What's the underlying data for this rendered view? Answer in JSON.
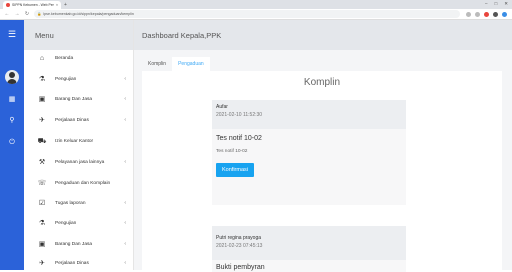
{
  "browser": {
    "tab_title": "SIPPN Kebumen - Web Pengad",
    "tab_close": "×",
    "new_tab": "+",
    "url": "lpse.kebumenkab.go.id/sippn/kepala/pengaduan/kemplin",
    "win_minimize": "–",
    "win_maximize": "□",
    "win_close": "✕"
  },
  "menu": {
    "title": "Menu",
    "items": [
      {
        "label": "Beranda",
        "icon": "home-icon",
        "chevron": ""
      },
      {
        "label": "Pengujian",
        "icon": "flask-icon",
        "chevron": "‹"
      },
      {
        "label": "Barang Dan Jasa",
        "icon": "box-icon",
        "chevron": "‹"
      },
      {
        "label": "Perjalaan Dinas",
        "icon": "plane-icon",
        "chevron": "‹"
      },
      {
        "label": "Izin Keluar Kantor",
        "icon": "car-icon",
        "chevron": ""
      },
      {
        "label": "Pelayanan jasa lainnya",
        "icon": "wrench-icon",
        "chevron": "‹"
      },
      {
        "label": "Pengaduan dan Komplain",
        "icon": "complaint-icon",
        "chevron": ""
      },
      {
        "label": "Tugas laporan",
        "icon": "checklist-icon",
        "chevron": "‹"
      },
      {
        "label": "Pengujian",
        "icon": "flask-icon",
        "chevron": "‹"
      },
      {
        "label": "Barang Dan Jasa",
        "icon": "box-icon",
        "chevron": "‹"
      },
      {
        "label": "Perjalaan Dinas",
        "icon": "plane-icon",
        "chevron": "‹"
      }
    ]
  },
  "header": {
    "title": "Dashboard Kepala,PPK"
  },
  "tabs": [
    {
      "label": "Komplin",
      "active": false
    },
    {
      "label": "Pengaduan",
      "active": true
    }
  ],
  "panel": {
    "title": "Komplin",
    "cards": [
      {
        "name": "Aufar",
        "date": "2021-02-10 11:52:30",
        "subject": "Tes notif 10-02",
        "message": "Tes notif 10-02",
        "button": "Konfirmasi"
      },
      {
        "name": "Putri regina prayoga",
        "date": "2021-02-23 07:45:13",
        "subject": "Bukti pembyran"
      }
    ]
  },
  "colors": {
    "rail": "#2b62d9",
    "accent": "#18a3f0",
    "active_tab": "#3fa9f5"
  }
}
